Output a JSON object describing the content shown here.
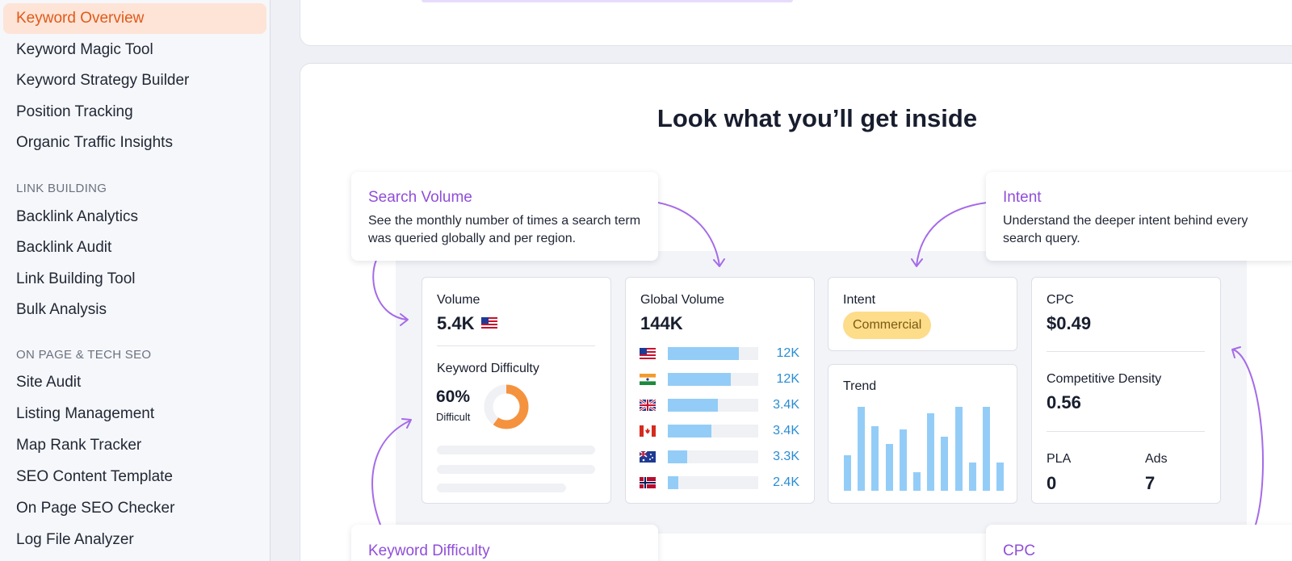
{
  "sidebar": {
    "items_top": [
      "Keyword Overview",
      "Keyword Magic Tool",
      "Keyword Strategy Builder",
      "Position Tracking",
      "Organic Traffic Insights"
    ],
    "section_link": "LINK BUILDING",
    "items_link": [
      "Backlink Analytics",
      "Backlink Audit",
      "Link Building Tool",
      "Bulk Analysis"
    ],
    "section_onpage": "ON PAGE & TECH SEO",
    "items_onpage": [
      "Site Audit",
      "Listing Management",
      "Map Rank Tracker",
      "SEO Content Template",
      "On Page SEO Checker",
      "Log File Analyzer"
    ]
  },
  "main": {
    "title": "Look what you’ll get inside",
    "callouts": {
      "search_volume": {
        "title": "Search Volume",
        "desc": "See the monthly number of times a search term was queried globally and per region."
      },
      "intent": {
        "title": "Intent",
        "desc": "Understand the deeper intent behind every search query."
      },
      "keyword_difficulty": {
        "title": "Keyword Difficulty"
      },
      "cpc": {
        "title": "CPC"
      }
    },
    "volume_card": {
      "volume_label": "Volume",
      "volume_value": "5.4K",
      "kd_label": "Keyword Difficulty",
      "kd_value": "60%",
      "kd_level": "Difficult",
      "kd_percent": 60
    },
    "global_volume_card": {
      "label": "Global Volume",
      "value": "144K",
      "rows": [
        {
          "country": "US",
          "value": "12K",
          "fill": 0.79
        },
        {
          "country": "IN",
          "value": "12K",
          "fill": 0.7
        },
        {
          "country": "UK",
          "value": "3.4K",
          "fill": 0.55
        },
        {
          "country": "CA",
          "value": "3.4K",
          "fill": 0.48
        },
        {
          "country": "AU",
          "value": "3.3K",
          "fill": 0.21
        },
        {
          "country": "NO",
          "value": "2.4K",
          "fill": 0.12
        }
      ]
    },
    "intent_card": {
      "label": "Intent",
      "badge": "Commercial"
    },
    "trend_card": {
      "label": "Trend",
      "values": [
        0.42,
        1.0,
        0.77,
        0.56,
        0.73,
        0.22,
        0.92,
        0.64,
        1.0,
        0.34,
        1.0,
        0.34
      ]
    },
    "cpc_card": {
      "cpc_label": "CPC",
      "cpc_value": "$0.49",
      "density_label": "Competitive Density",
      "density_value": "0.56",
      "pla_label": "PLA",
      "pla_value": "0",
      "ads_label": "Ads",
      "ads_value": "7"
    },
    "colors": {
      "accent": "#8f4ed9",
      "bar": "#93cdf7",
      "kd_ring": "#f5923e",
      "badge": "#fddc8a",
      "active_nav": "#e05a1b"
    }
  }
}
